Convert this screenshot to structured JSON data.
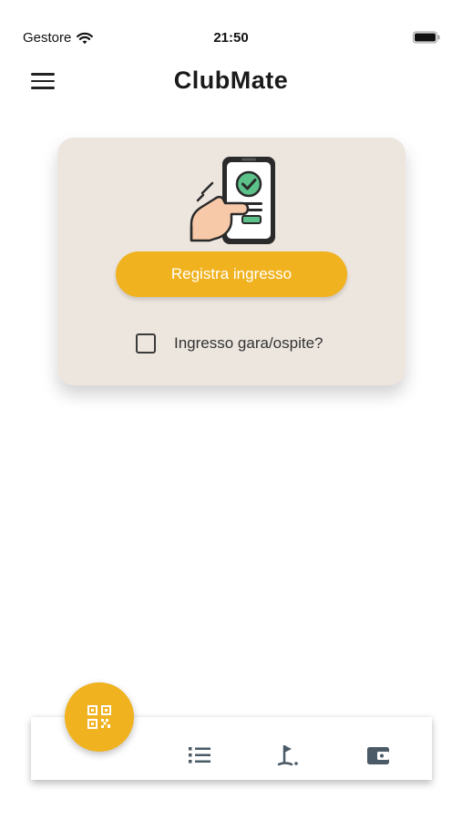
{
  "status_bar": {
    "carrier": "Gestore",
    "time": "21:50"
  },
  "app_bar": {
    "title": "ClubMate"
  },
  "entry_card": {
    "register_button_label": "Registra ingresso",
    "guest_checkbox_label": "Ingresso gara/ospite?",
    "guest_checked": false
  },
  "bottom_nav": {
    "items": [
      {
        "icon": "qr-code-icon"
      },
      {
        "icon": "list-icon"
      },
      {
        "icon": "golf-flag-icon"
      },
      {
        "icon": "wallet-icon"
      }
    ]
  },
  "colors": {
    "accent": "#f0b21e",
    "card_background": "#ede6df",
    "nav_icon": "#4a5a66"
  }
}
